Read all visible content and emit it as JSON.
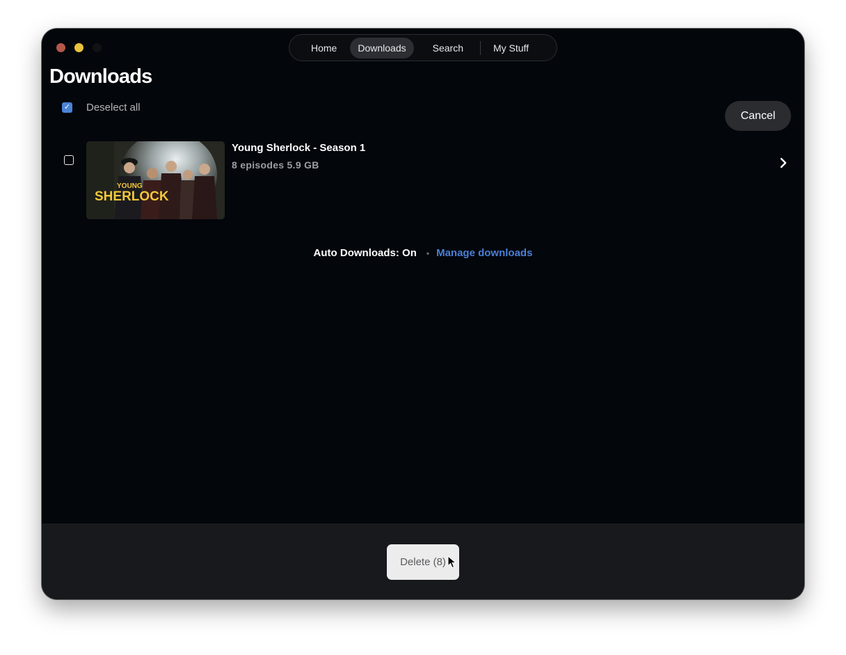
{
  "window": {
    "controls": [
      "close",
      "minimize",
      "maximize"
    ]
  },
  "nav": {
    "items": [
      {
        "label": "Home",
        "active": false
      },
      {
        "label": "Downloads",
        "active": true
      },
      {
        "label": "Search",
        "active": false
      },
      {
        "label": "My Stuff",
        "active": false
      }
    ]
  },
  "page": {
    "title": "Downloads",
    "select_all_label": "Deselect all",
    "select_all_checked": true,
    "cancel_label": "Cancel"
  },
  "downloads": [
    {
      "title": "Young Sherlock - Season 1",
      "meta": "8 episodes 5.9 GB",
      "checked": false,
      "thumbnail_text": [
        "YOUNG",
        "SHERLOCK"
      ]
    }
  ],
  "footer_info": {
    "auto_downloads": "Auto Downloads: On",
    "bullet": "•",
    "manage_link": "Manage downloads"
  },
  "bottom_bar": {
    "delete_label": "Delete (8)"
  },
  "colors": {
    "background": "#03060b",
    "accent_link": "#4b7fd6",
    "checkbox": "#4b82d6",
    "thumbnail_title": "#f2c83a"
  }
}
